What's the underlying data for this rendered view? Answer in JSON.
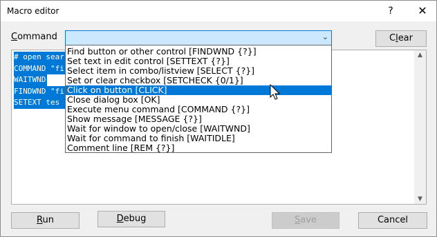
{
  "window": {
    "title": "Macro editor",
    "help": "?",
    "close": "✕"
  },
  "command": {
    "label_pre": "",
    "label_u": "C",
    "label_post": "ommand",
    "chevron": "⌄"
  },
  "clear_button": {
    "pre": "C",
    "u": "l",
    "post": "ear"
  },
  "editor": {
    "lines": [
      "# open sear",
      "COMMAND \"fi",
      "WAITWND",
      "FINDWND \"fi",
      "SETEXT tes"
    ]
  },
  "dropdown": {
    "items": [
      "Find button or other control [FINDWND {?}]",
      "Set text in edit control [SETTEXT {?}]",
      "Select item in combo/listview [SELECT {?}]",
      "Set or clear checkbox [SETCHECK {0/1}]",
      "Click on button [CLICK]",
      "Close dialog box [OK]",
      "Execute menu command [COMMAND {?}]",
      "Show message [MESSAGE {?}]",
      "Wait for window to open/close [WAITWND]",
      "Wait for command to finish [WAITIDLE]",
      "Comment line [REM {?}]"
    ],
    "selected_index": 4
  },
  "buttons": {
    "run": {
      "u": "R",
      "post": "un"
    },
    "debug": {
      "u": "D",
      "post": "ebug"
    },
    "save": {
      "u": "S",
      "post": "ave"
    },
    "cancel": "Cancel"
  }
}
